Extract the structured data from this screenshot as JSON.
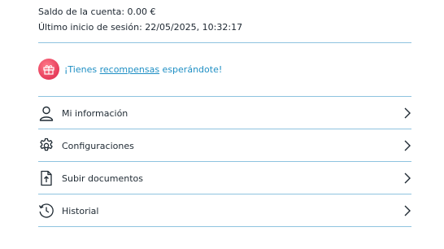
{
  "account": {
    "balance_line": "Saldo de la cuenta: 0.00 €",
    "last_login_line": "Último inicio de sesión: 22/05/2025, 10:32:17"
  },
  "rewards": {
    "prefix": "¡Tienes ",
    "link": "recompensas",
    "suffix": " esperándote!"
  },
  "menu": {
    "items": [
      {
        "label": "Mi información",
        "icon": "user-icon"
      },
      {
        "label": "Configuraciones",
        "icon": "gear-icon"
      },
      {
        "label": "Subir documentos",
        "icon": "upload-document-icon"
      },
      {
        "label": "Historial",
        "icon": "history-icon"
      }
    ]
  },
  "colors": {
    "divider": "#8ec3df",
    "link": "#1f8fc4",
    "badge": "#e63b5a"
  }
}
